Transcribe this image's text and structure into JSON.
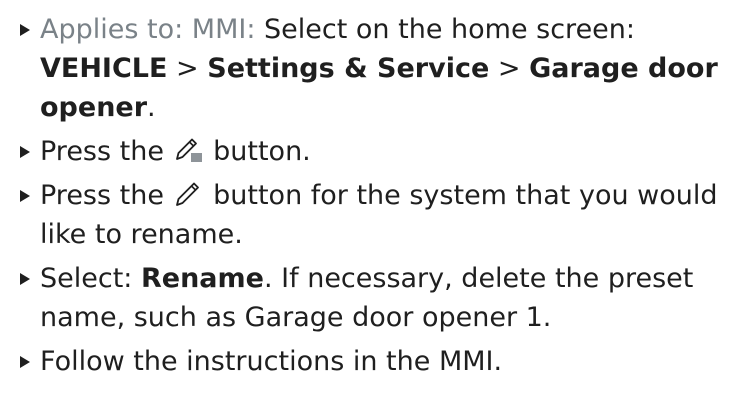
{
  "steps": [
    {
      "prefix": "Applies to: MMI:",
      "text": " Select on the home screen:",
      "path": [
        "VEHICLE",
        " > ",
        "Settings & Service",
        " > ",
        "Garage door opener"
      ],
      "end": "."
    },
    {
      "before": "Press the ",
      "icon": "edit-list-icon",
      "after": " button."
    },
    {
      "before": "Press the ",
      "icon": "pencil-icon",
      "after": " button for the system that you would like to rename."
    },
    {
      "before": "Select: ",
      "bold": "Rename",
      "after": ". If necessary, delete the preset name, such as Garage door opener 1."
    },
    {
      "text": "Follow the instructions in the MMI."
    }
  ]
}
